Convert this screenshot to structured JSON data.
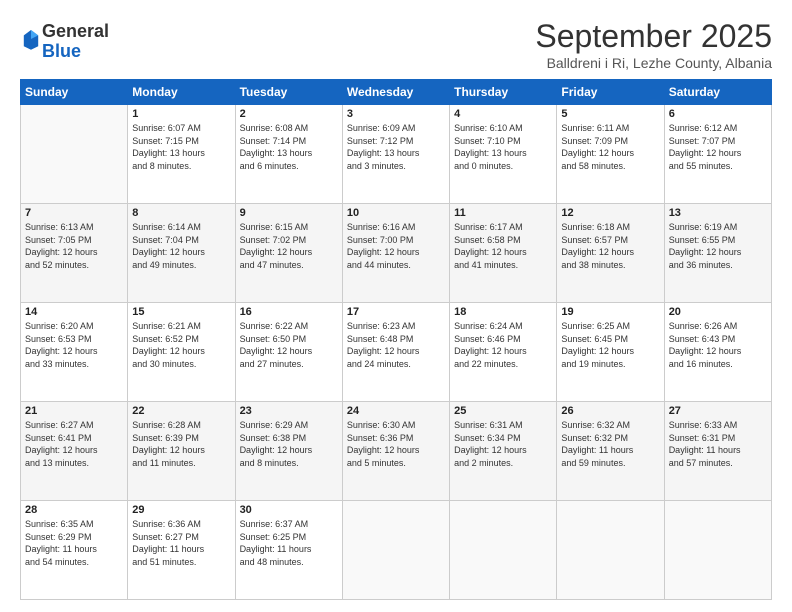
{
  "logo": {
    "general": "General",
    "blue": "Blue"
  },
  "title": "September 2025",
  "subtitle": "Balldreni i Ri, Lezhe County, Albania",
  "days": [
    "Sunday",
    "Monday",
    "Tuesday",
    "Wednesday",
    "Thursday",
    "Friday",
    "Saturday"
  ],
  "weeks": [
    [
      {
        "day": "",
        "content": ""
      },
      {
        "day": "1",
        "content": "Sunrise: 6:07 AM\nSunset: 7:15 PM\nDaylight: 13 hours\nand 8 minutes."
      },
      {
        "day": "2",
        "content": "Sunrise: 6:08 AM\nSunset: 7:14 PM\nDaylight: 13 hours\nand 6 minutes."
      },
      {
        "day": "3",
        "content": "Sunrise: 6:09 AM\nSunset: 7:12 PM\nDaylight: 13 hours\nand 3 minutes."
      },
      {
        "day": "4",
        "content": "Sunrise: 6:10 AM\nSunset: 7:10 PM\nDaylight: 13 hours\nand 0 minutes."
      },
      {
        "day": "5",
        "content": "Sunrise: 6:11 AM\nSunset: 7:09 PM\nDaylight: 12 hours\nand 58 minutes."
      },
      {
        "day": "6",
        "content": "Sunrise: 6:12 AM\nSunset: 7:07 PM\nDaylight: 12 hours\nand 55 minutes."
      }
    ],
    [
      {
        "day": "7",
        "content": "Sunrise: 6:13 AM\nSunset: 7:05 PM\nDaylight: 12 hours\nand 52 minutes."
      },
      {
        "day": "8",
        "content": "Sunrise: 6:14 AM\nSunset: 7:04 PM\nDaylight: 12 hours\nand 49 minutes."
      },
      {
        "day": "9",
        "content": "Sunrise: 6:15 AM\nSunset: 7:02 PM\nDaylight: 12 hours\nand 47 minutes."
      },
      {
        "day": "10",
        "content": "Sunrise: 6:16 AM\nSunset: 7:00 PM\nDaylight: 12 hours\nand 44 minutes."
      },
      {
        "day": "11",
        "content": "Sunrise: 6:17 AM\nSunset: 6:58 PM\nDaylight: 12 hours\nand 41 minutes."
      },
      {
        "day": "12",
        "content": "Sunrise: 6:18 AM\nSunset: 6:57 PM\nDaylight: 12 hours\nand 38 minutes."
      },
      {
        "day": "13",
        "content": "Sunrise: 6:19 AM\nSunset: 6:55 PM\nDaylight: 12 hours\nand 36 minutes."
      }
    ],
    [
      {
        "day": "14",
        "content": "Sunrise: 6:20 AM\nSunset: 6:53 PM\nDaylight: 12 hours\nand 33 minutes."
      },
      {
        "day": "15",
        "content": "Sunrise: 6:21 AM\nSunset: 6:52 PM\nDaylight: 12 hours\nand 30 minutes."
      },
      {
        "day": "16",
        "content": "Sunrise: 6:22 AM\nSunset: 6:50 PM\nDaylight: 12 hours\nand 27 minutes."
      },
      {
        "day": "17",
        "content": "Sunrise: 6:23 AM\nSunset: 6:48 PM\nDaylight: 12 hours\nand 24 minutes."
      },
      {
        "day": "18",
        "content": "Sunrise: 6:24 AM\nSunset: 6:46 PM\nDaylight: 12 hours\nand 22 minutes."
      },
      {
        "day": "19",
        "content": "Sunrise: 6:25 AM\nSunset: 6:45 PM\nDaylight: 12 hours\nand 19 minutes."
      },
      {
        "day": "20",
        "content": "Sunrise: 6:26 AM\nSunset: 6:43 PM\nDaylight: 12 hours\nand 16 minutes."
      }
    ],
    [
      {
        "day": "21",
        "content": "Sunrise: 6:27 AM\nSunset: 6:41 PM\nDaylight: 12 hours\nand 13 minutes."
      },
      {
        "day": "22",
        "content": "Sunrise: 6:28 AM\nSunset: 6:39 PM\nDaylight: 12 hours\nand 11 minutes."
      },
      {
        "day": "23",
        "content": "Sunrise: 6:29 AM\nSunset: 6:38 PM\nDaylight: 12 hours\nand 8 minutes."
      },
      {
        "day": "24",
        "content": "Sunrise: 6:30 AM\nSunset: 6:36 PM\nDaylight: 12 hours\nand 5 minutes."
      },
      {
        "day": "25",
        "content": "Sunrise: 6:31 AM\nSunset: 6:34 PM\nDaylight: 12 hours\nand 2 minutes."
      },
      {
        "day": "26",
        "content": "Sunrise: 6:32 AM\nSunset: 6:32 PM\nDaylight: 11 hours\nand 59 minutes."
      },
      {
        "day": "27",
        "content": "Sunrise: 6:33 AM\nSunset: 6:31 PM\nDaylight: 11 hours\nand 57 minutes."
      }
    ],
    [
      {
        "day": "28",
        "content": "Sunrise: 6:35 AM\nSunset: 6:29 PM\nDaylight: 11 hours\nand 54 minutes."
      },
      {
        "day": "29",
        "content": "Sunrise: 6:36 AM\nSunset: 6:27 PM\nDaylight: 11 hours\nand 51 minutes."
      },
      {
        "day": "30",
        "content": "Sunrise: 6:37 AM\nSunset: 6:25 PM\nDaylight: 11 hours\nand 48 minutes."
      },
      {
        "day": "",
        "content": ""
      },
      {
        "day": "",
        "content": ""
      },
      {
        "day": "",
        "content": ""
      },
      {
        "day": "",
        "content": ""
      }
    ]
  ]
}
